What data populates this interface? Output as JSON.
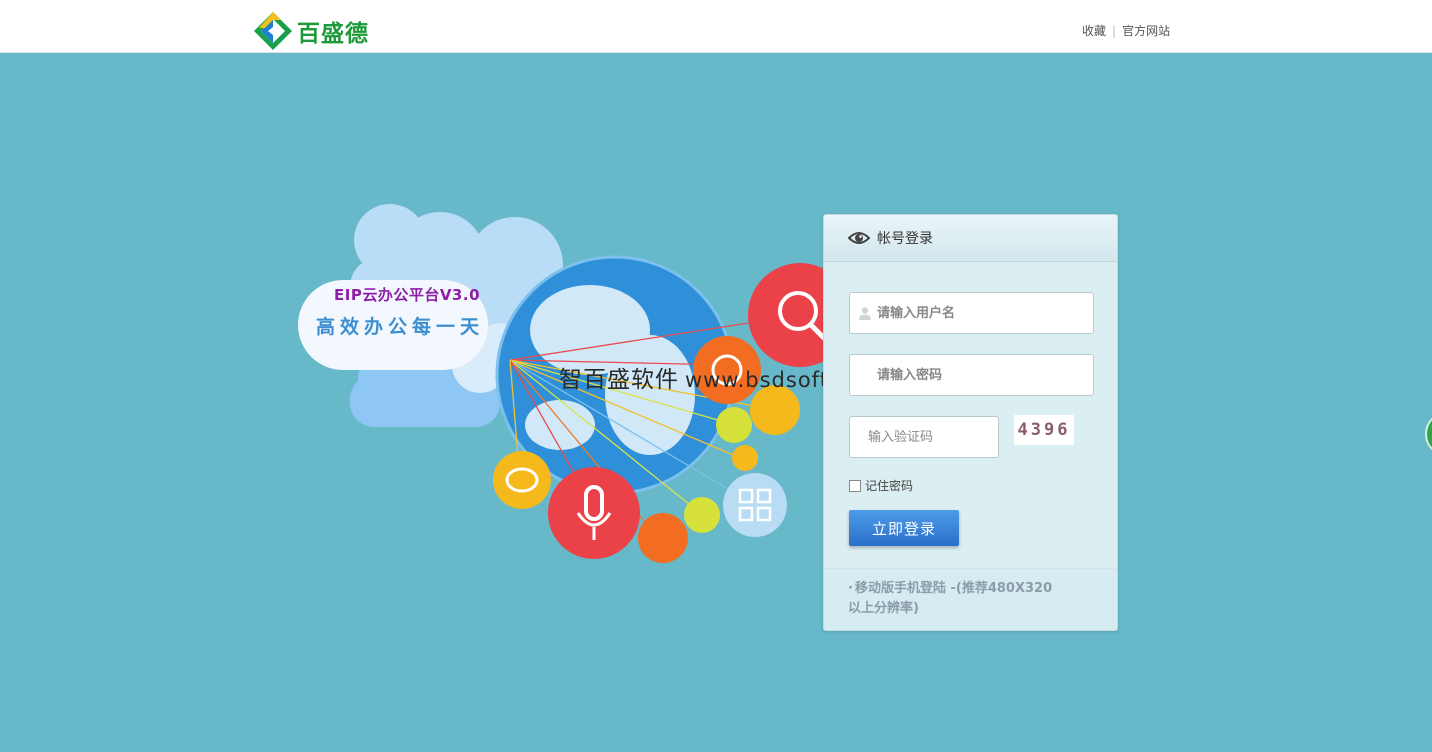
{
  "header": {
    "logo_text": "百盛德",
    "links": [
      {
        "label": "收藏"
      },
      {
        "label": "官方网站"
      }
    ]
  },
  "hero": {
    "slogan_line1": "EIP云办公平台V3.0",
    "slogan_line2": "高效办公每一天",
    "watermark_cn": "智百盛软件",
    "watermark_url": "www.bsdsoft.cn"
  },
  "login": {
    "title": "帐号登录",
    "username_placeholder": "请输入用户名",
    "password_placeholder": "请输入密码",
    "captcha_placeholder": "输入验证码",
    "captcha_value": "4396",
    "remember_label": "记住密码",
    "submit_label": "立即登录",
    "mobile_link_text": "移动版手机登陆 -(推荐480X320 以上分辨率)"
  },
  "colors": {
    "background": "#67b8c9",
    "brand_green": "#1e9a3a",
    "button_blue": "#2a70c9",
    "slogan_purple": "#8e1fa8"
  }
}
